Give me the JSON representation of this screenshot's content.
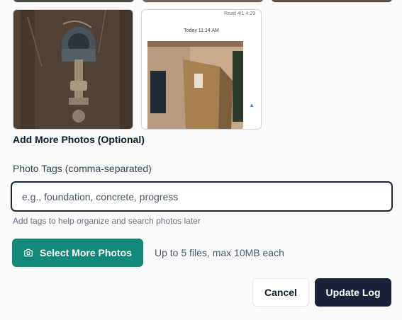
{
  "photos": {
    "add_more_label": "Add More Photos (Optional)",
    "items": [
      {
        "name": "water-meter-photo"
      },
      {
        "name": "screenshot-photo",
        "status_text": "Read 4/1 4:29",
        "timestamp": "Today 11:14 AM"
      }
    ]
  },
  "tags": {
    "label": "Photo Tags (comma-separated)",
    "placeholder": "e.g., foundation, concrete, progress",
    "value": "",
    "help": "Add tags to help organize and search photos later"
  },
  "upload": {
    "button_label": "Select More Photos",
    "button_icon": "camera-icon",
    "limit_text": "Up to 5 files, max 10MB each"
  },
  "actions": {
    "cancel_label": "Cancel",
    "submit_label": "Update Log"
  },
  "colors": {
    "accent": "#138a78",
    "primary_dark": "#1a2138",
    "focus_border": "#1e2536"
  }
}
